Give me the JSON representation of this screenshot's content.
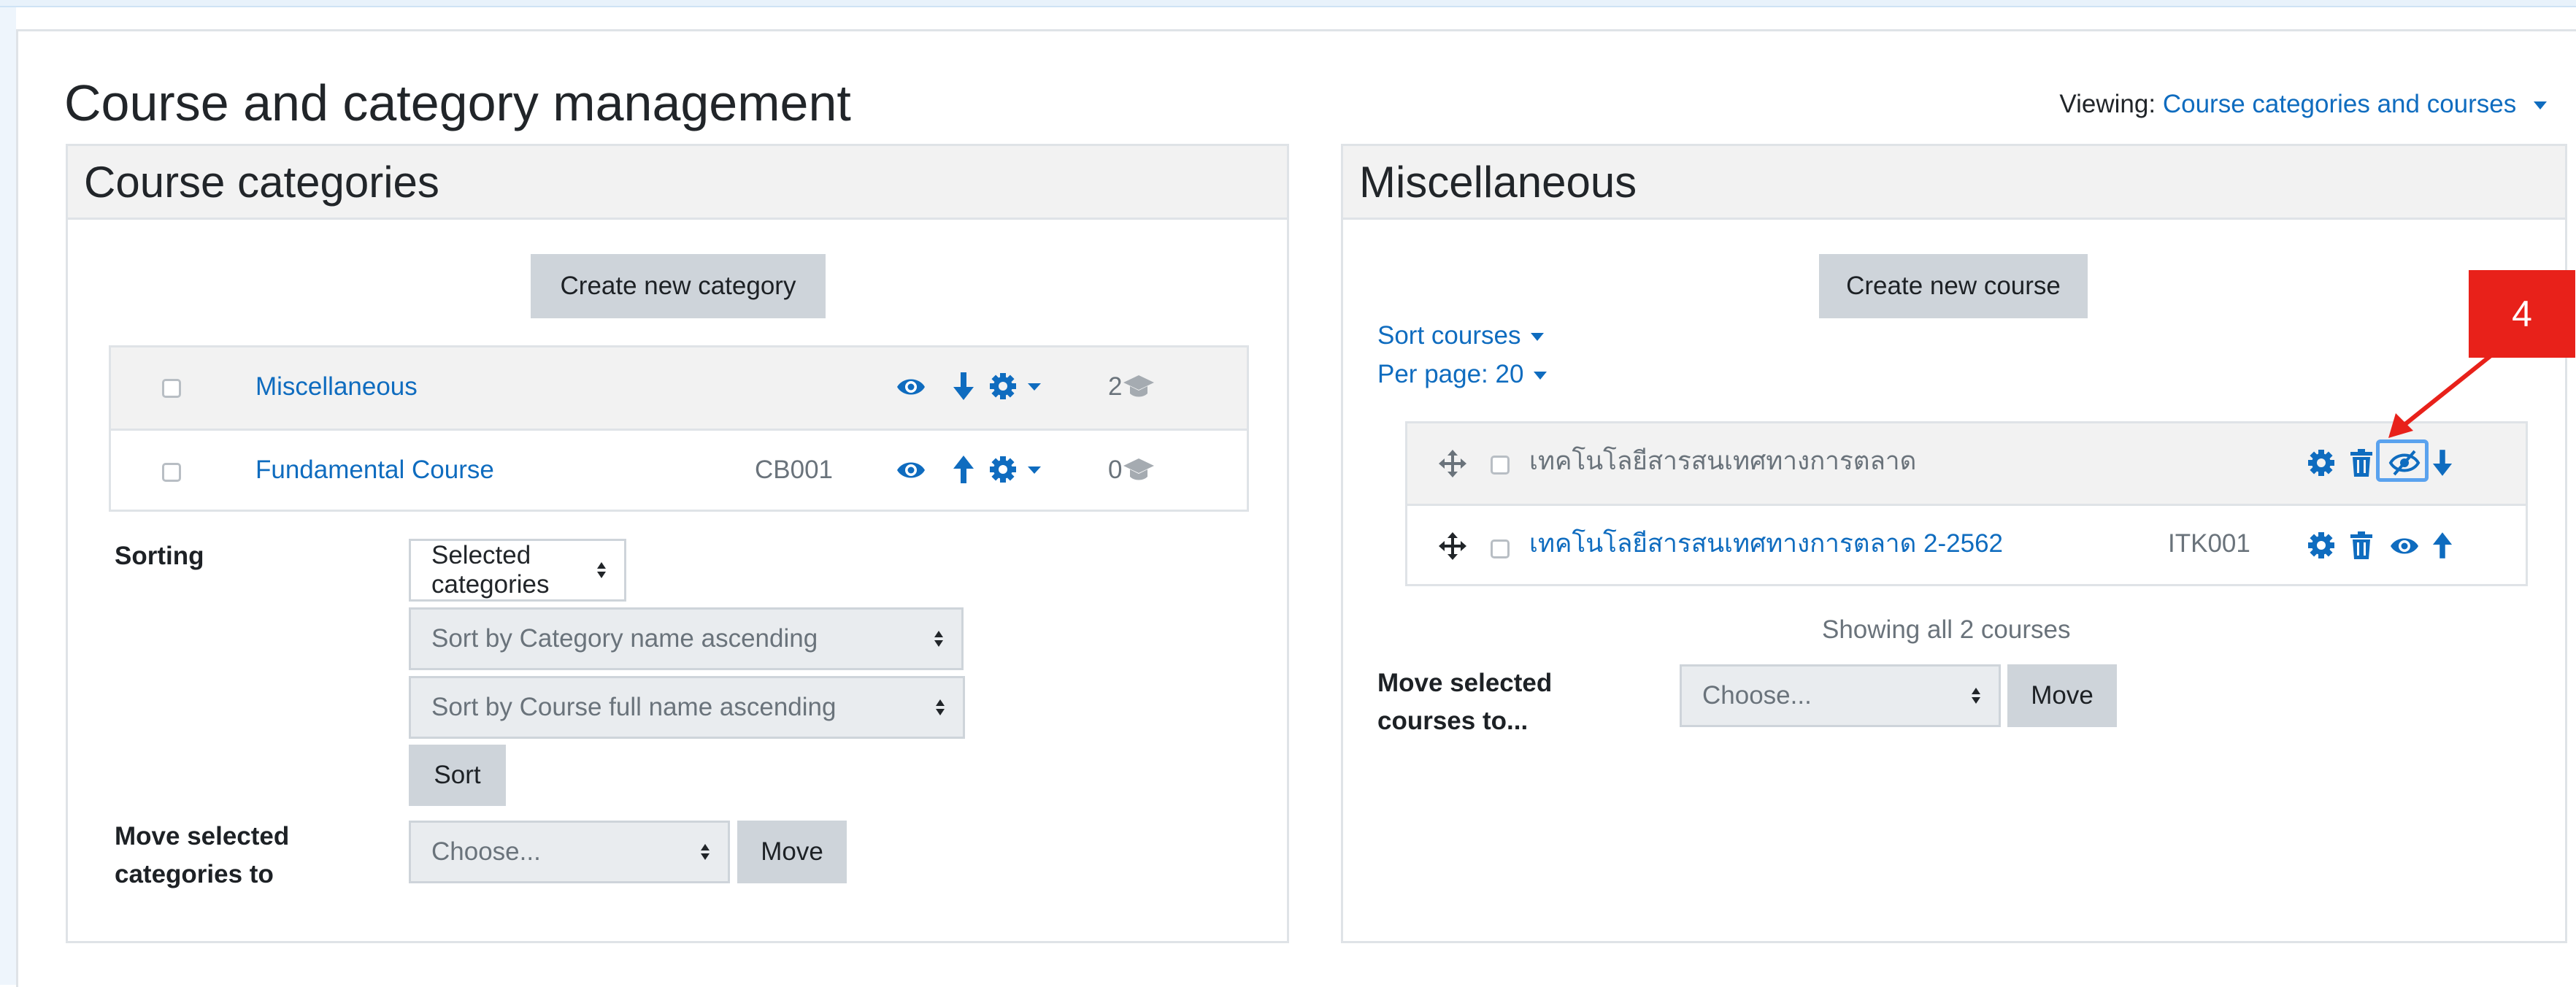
{
  "page": {
    "title": "Course and category management",
    "viewing_label": "Viewing:",
    "viewing_value": "Course categories and courses"
  },
  "categories_panel": {
    "heading": "Course categories",
    "create_button": "Create new category",
    "rows": [
      {
        "name": "Miscellaneous",
        "idnumber": "",
        "count": "2"
      },
      {
        "name": "Fundamental Course",
        "idnumber": "CB001",
        "count": "0"
      }
    ],
    "sorting_label": "Sorting",
    "sort_selects": [
      "Selected categories",
      "Sort by Category name ascending",
      "Sort by Course full name ascending"
    ],
    "sort_button": "Sort",
    "move_label_1": "Move selected",
    "move_label_2": "categories to",
    "move_select": "Choose...",
    "move_button": "Move"
  },
  "courses_panel": {
    "heading": "Miscellaneous",
    "create_button": "Create new course",
    "sort_courses": "Sort courses",
    "per_page": "Per page: 20",
    "rows": [
      {
        "name": "เทคโนโลยีสารสนเทศทางการตลาด",
        "idnumber": "",
        "hidden": true
      },
      {
        "name": "เทคโนโลยีสารสนเทศทางการตลาด 2-2562",
        "idnumber": "ITK001",
        "hidden": false
      }
    ],
    "showing": "Showing all 2 courses",
    "move_label_1": "Move selected",
    "move_label_2": "courses to...",
    "move_select": "Choose...",
    "move_button": "Move"
  },
  "annotation": {
    "number": "4",
    "color": "#e8211a"
  },
  "colors": {
    "link": "#0f6cbf",
    "button_bg": "#ced4da",
    "border": "#dfe3e7",
    "header_bg": "#f2f2f2"
  }
}
